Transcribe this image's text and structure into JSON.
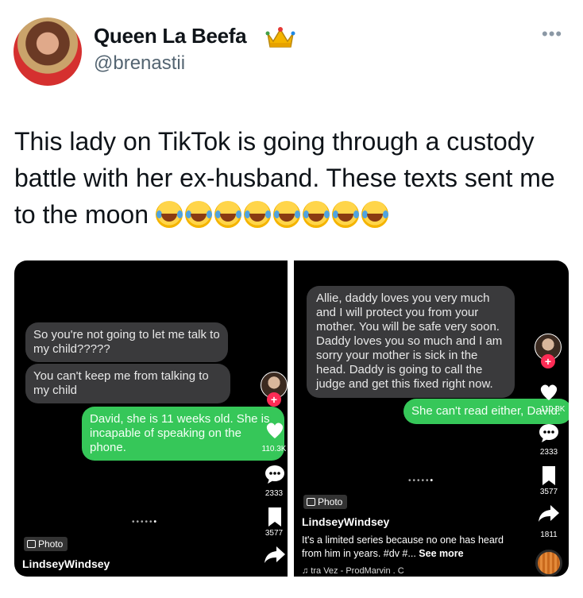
{
  "author": {
    "display_name": "Queen La Beefa",
    "handle": "@brenastii",
    "badge_emoji": "crown",
    "more_label": "•••"
  },
  "tweet": {
    "text": "This lady on TikTok is going through a custody battle with her ex-husband. These texts sent me to the moon",
    "emoji_icon": "face-with-tears-of-joy-icon",
    "emoji_count": 8
  },
  "left_screenshot": {
    "messages": [
      {
        "from": "them",
        "text": "So you're not going to let me talk to my child?????"
      },
      {
        "from": "them",
        "text": "You can't keep me from talking to my child"
      },
      {
        "from": "me",
        "text": "David, she is 11 weeks old. She is incapable of speaking on the phone."
      }
    ],
    "like_count": "110.3K",
    "comment_count": "2333",
    "save_count": "3577",
    "photo_label": "Photo",
    "username": "LindseyWindsey",
    "dots": "•••••",
    "active_dot": "•"
  },
  "right_screenshot": {
    "messages": [
      {
        "from": "them",
        "text": "Allie, daddy loves you very much and I will protect you from your mother. You will be safe very soon. Daddy loves you so much and I am sorry your mother is sick in the head. Daddy is going to call the judge and get this fixed right now."
      },
      {
        "from": "me",
        "text": "She can't read either, David."
      }
    ],
    "like_count": "110.3K",
    "comment_count": "2333",
    "save_count": "3577",
    "share_count": "1811",
    "photo_label": "Photo",
    "username": "LindseyWindsey",
    "caption": "It's a limited series because no one has heard from him in years. #dv #...",
    "see_more": "See more",
    "music": "♫ tra Vez - ProdMarvin . C",
    "dots": "•••••",
    "active_dot": "•"
  },
  "colors": {
    "imessage_green": "#36c759",
    "imessage_gray": "#3a3a3c",
    "tiktok_red": "#fe2c55",
    "handle_gray": "#536471"
  }
}
